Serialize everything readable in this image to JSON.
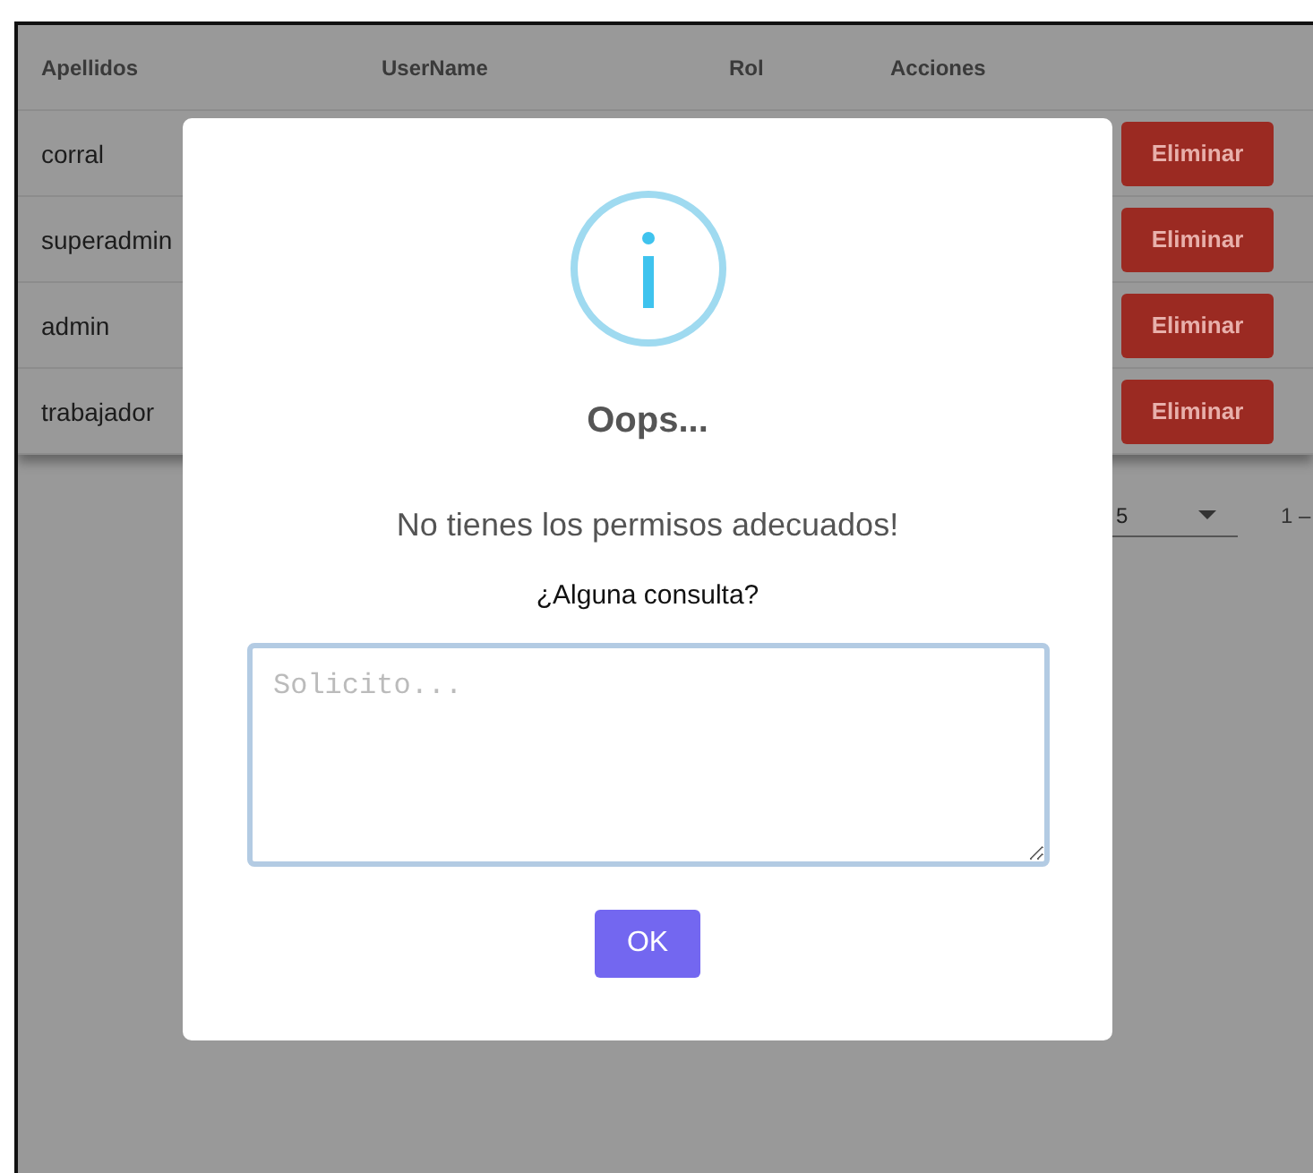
{
  "table": {
    "columns": [
      "Apellidos",
      "UserName",
      "Rol",
      "Acciones"
    ],
    "rows": [
      {
        "apellidos": "corral",
        "action": "Eliminar"
      },
      {
        "apellidos": "superadmin",
        "action": "Eliminar"
      },
      {
        "apellidos": "admin",
        "action": "Eliminar"
      },
      {
        "apellidos": "trabajador",
        "action": "Eliminar"
      }
    ]
  },
  "paginator": {
    "page_size": "5",
    "range": "1 –"
  },
  "dialog": {
    "title": "Oops...",
    "message": "No tienes los permisos adecuados!",
    "question": "¿Alguna consulta?",
    "placeholder": "Solicito...",
    "button": "OK"
  }
}
